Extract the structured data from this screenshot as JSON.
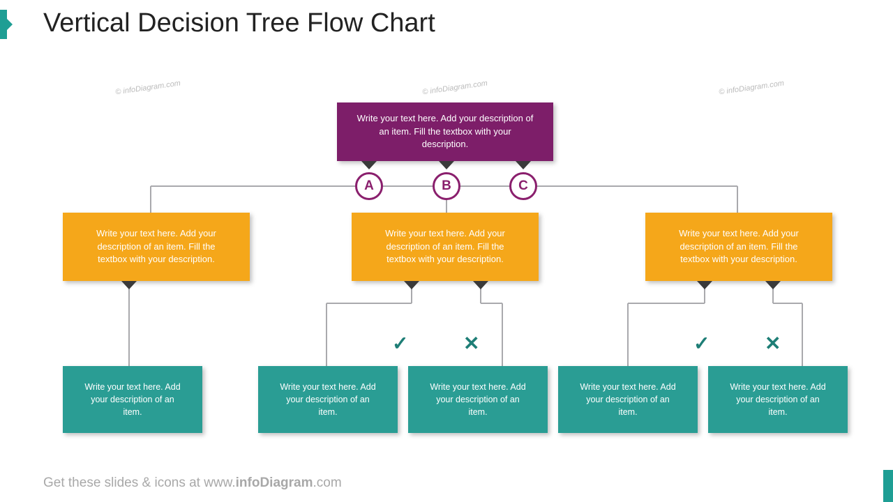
{
  "title": "Vertical Decision Tree Flow Chart",
  "watermark": "© infoDiagram.com",
  "footer": {
    "pre": "Get these slides & icons at www.",
    "bold": "infoDiagram",
    "post": ".com"
  },
  "colors": {
    "accent": "#1e9e94",
    "top": "#7d1e69",
    "mid": "#f5a71a",
    "leaf": "#2a9d94",
    "circle": "#8a1f6d",
    "mark": "#1e7e76"
  },
  "top_box": "Write your text here. Add your description of an item. Fill the textbox with your description.",
  "options": {
    "a": "A",
    "b": "B",
    "c": "C"
  },
  "mid": {
    "left": "Write your text here. Add your description of an item. Fill the textbox with your description.",
    "center": "Write your text here. Add your description of an item. Fill the textbox with your description.",
    "right": "Write your text here. Add your description of an item. Fill the textbox with your description."
  },
  "leaf": {
    "l1": "Write your text here. Add your description of an item.",
    "l2": "Write your text here. Add your description of an item.",
    "l3": "Write your text here. Add your description of an item.",
    "l4": "Write your text here. Add your description of an item.",
    "l5": "Write your text here. Add your description of an item."
  },
  "marks": {
    "check": "✓",
    "cross": "✕"
  }
}
